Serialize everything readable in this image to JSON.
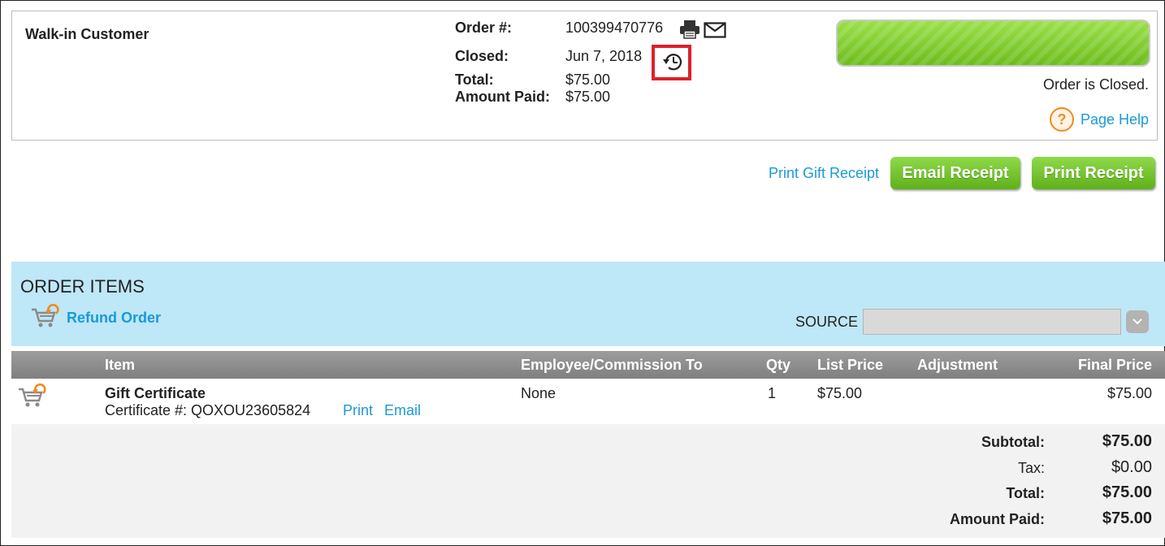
{
  "customer": {
    "name": "Walk-in Customer"
  },
  "order": {
    "number_label": "Order #:",
    "number": "100399470776",
    "closed_label": "Closed:",
    "closed_date": "Jun 7, 2018",
    "total_label": "Total:",
    "total": "$75.00",
    "amount_paid_label": "Amount Paid:",
    "amount_paid": "$75.00"
  },
  "status": {
    "message": "Order is Closed."
  },
  "help": {
    "label": "Page Help",
    "icon_glyph": "?"
  },
  "receipts": {
    "gift_label": "Print Gift Receipt",
    "email_label": "Email Receipt",
    "print_label": "Print Receipt"
  },
  "items_section": {
    "title": "ORDER ITEMS",
    "refund_label": "Refund Order",
    "source_label": "SOURCE",
    "source_value": ""
  },
  "table": {
    "headers": {
      "item": "Item",
      "employee": "Employee/Commission To",
      "qty": "Qty",
      "list_price": "List Price",
      "adjustment": "Adjustment",
      "final_price": "Final Price"
    },
    "rows": [
      {
        "item_name": "Gift Certificate",
        "certificate": "Certificate #: QOXOU23605824",
        "print_label": "Print",
        "email_label": "Email",
        "employee": "None",
        "qty": "1",
        "list_price": "$75.00",
        "adjustment": "",
        "final_price": "$75.00"
      }
    ]
  },
  "totals": {
    "subtotal_label": "Subtotal:",
    "subtotal": "$75.00",
    "tax_label": "Tax:",
    "tax": "$0.00",
    "total_label": "Total:",
    "total": "$75.00",
    "amount_paid_label": "Amount Paid:",
    "amount_paid": "$75.00"
  },
  "colors": {
    "accent_green": "#6cbd1d",
    "link_blue": "#1a9ad6",
    "panel_blue": "#bee7f8",
    "highlight_red": "#e0202a"
  }
}
